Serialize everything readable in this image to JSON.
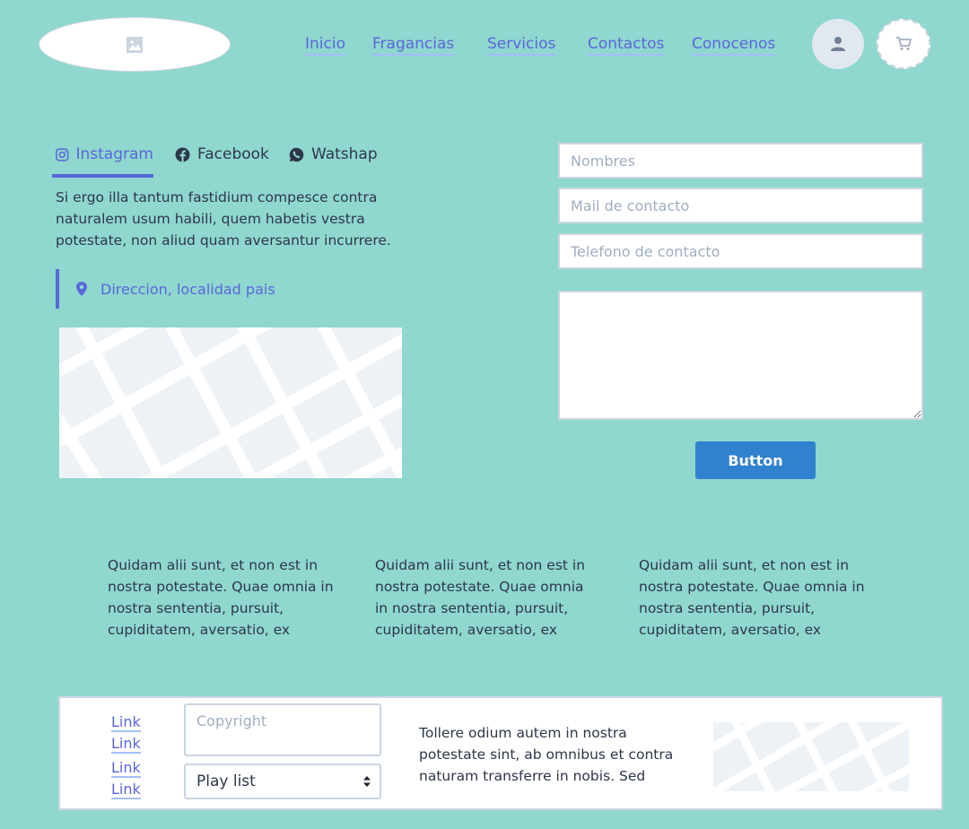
{
  "nav": {
    "items": [
      {
        "label": "Inicio"
      },
      {
        "label": "Fragancias"
      },
      {
        "label": "Servicios"
      },
      {
        "label": "Contactos"
      },
      {
        "label": "Conocenos"
      }
    ]
  },
  "social_tabs": [
    {
      "label": "Instagram",
      "icon": "instagram-icon",
      "active": true
    },
    {
      "label": "Facebook",
      "icon": "facebook-icon",
      "active": false
    },
    {
      "label": "Watshap",
      "icon": "whatsapp-icon",
      "active": false
    }
  ],
  "contact": {
    "description": "Si ergo illa tantum fastidium compesce contra naturalem usum habili, quem habetis vestra potestate, non aliud quam aversantur incurrere.",
    "address": "Direccion, localidad pais"
  },
  "form": {
    "name_placeholder": "Nombres",
    "email_placeholder": "Mail de contacto",
    "phone_placeholder": "Telefono de contacto",
    "button_label": "Button"
  },
  "columns": [
    {
      "text": "Quidam alii sunt, et non est in nostra potestate. Quae omnia in nostra sententia, pursuit, cupiditatem, aversatio, ex"
    },
    {
      "text": "Quidam alii sunt, et non est in nostra potestate. Quae omnia in nostra sententia, pursuit, cupiditatem, aversatio, ex"
    },
    {
      "text": "Quidam alii sunt, et non est in nostra potestate. Quae omnia in nostra sententia, pursuit, cupiditatem, aversatio, ex"
    }
  ],
  "footer": {
    "links": [
      {
        "label": "Link"
      },
      {
        "label": "Link"
      },
      {
        "label": "Link"
      },
      {
        "label": "Link"
      }
    ],
    "copyright_placeholder": "Copyright",
    "select_value": "Play list",
    "text": "Tollere odium autem in nostra potestate sint, ab omnibus et contra naturam transferre in nobis. Sed"
  },
  "colors": {
    "background": "#8fd7cf",
    "accent": "#5a67d8",
    "button": "#3182ce"
  }
}
